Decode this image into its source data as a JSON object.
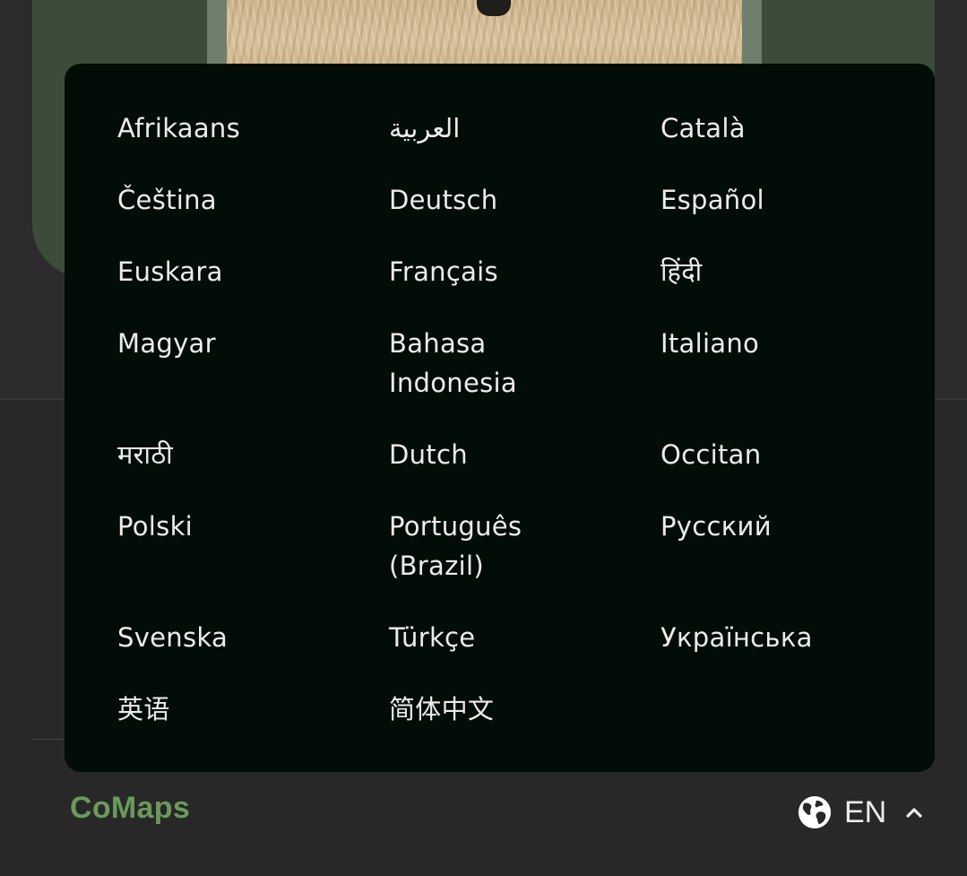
{
  "languages": [
    "Afrikaans",
    "العربية",
    "Català",
    "Čeština",
    "Deutsch",
    "Español",
    "Euskara",
    "Français",
    "हिंदी",
    "Magyar",
    "Bahasa Indonesia",
    "Italiano",
    "मराठी",
    "Dutch",
    "Occitan",
    "Polski",
    "Português (Brazil)",
    "Русский",
    "Svenska",
    "Türkçe",
    "Українська",
    "英语",
    "简体中文"
  ],
  "footer": {
    "brand": "CoMaps",
    "current_language": "EN",
    "globe_icon": "globe-icon",
    "chevron_icon": "chevron-up-icon",
    "brand_color": "#6b9a5c"
  },
  "colors": {
    "menu_background": "#030d08",
    "page_background": "#282828",
    "card_green": "#3b4d38"
  }
}
